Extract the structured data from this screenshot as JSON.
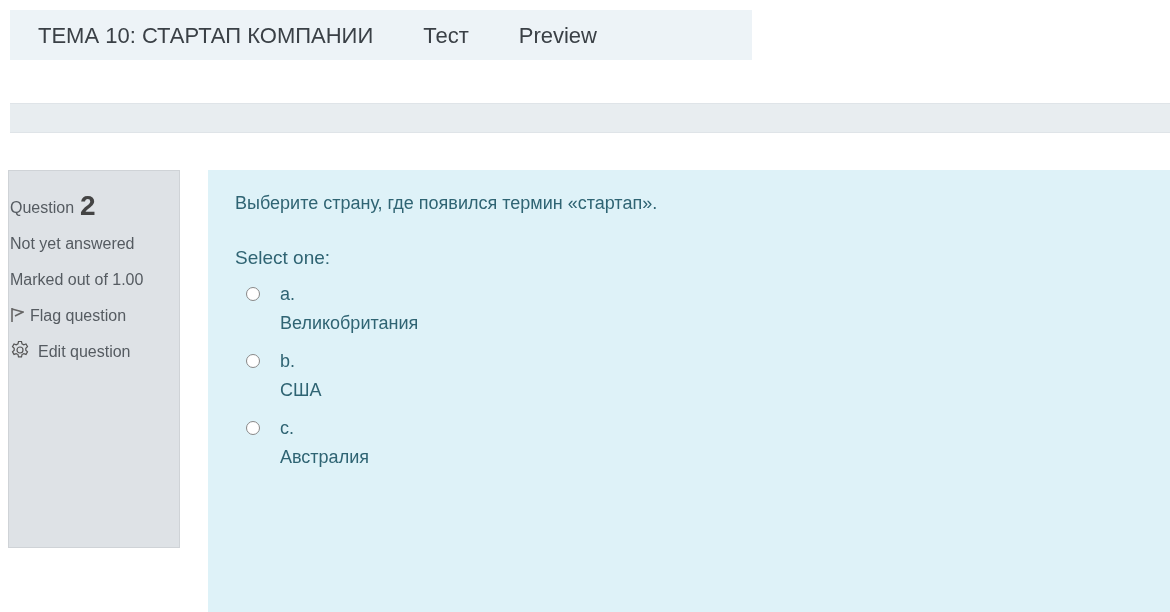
{
  "breadcrumb": [
    {
      "label": "ТЕМА 10: СТАРТАП КОМПАНИИ"
    },
    {
      "label": "Тест"
    },
    {
      "label": "Preview"
    }
  ],
  "info": {
    "question_label": "Question",
    "question_number": "2",
    "state": "Not yet answered",
    "marks": "Marked out of 1.00",
    "flag": "Flag question",
    "edit": "Edit question"
  },
  "question": {
    "text": "Выберите страну, где появился термин «стартап».",
    "prompt": "Select one:",
    "options": [
      {
        "letter": "a.",
        "label": "Великобритания",
        "selected": false
      },
      {
        "letter": "b.",
        "label": "США",
        "selected": false
      },
      {
        "letter": "c.",
        "label": "Австралия",
        "selected": false
      }
    ]
  }
}
